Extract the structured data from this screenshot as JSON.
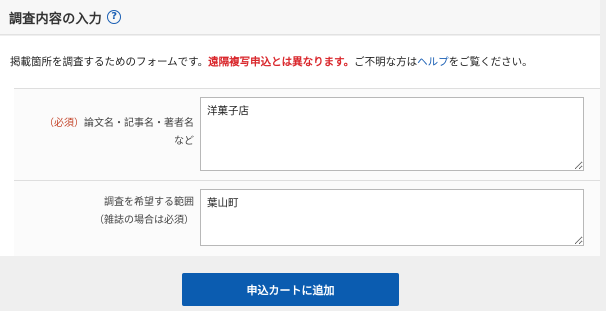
{
  "section": {
    "title": "調査内容の入力",
    "help_icon": "?"
  },
  "description": {
    "text_before": "掲載箇所を調査するためのフォームです。",
    "warning": "遠隔複写申込とは異なります。",
    "text_middle": "ご不明な方は",
    "help_link": "ヘルプ",
    "text_after": "をご覧ください。"
  },
  "form": {
    "rows": [
      {
        "required_label": "（必須）",
        "label_line1": "論文名・記事名・著者名",
        "label_line2": "など",
        "value": "洋菓子店"
      },
      {
        "label_line1": "調査を希望する範囲",
        "label_line2": "（雑誌の場合は必須）",
        "value": "葉山町"
      }
    ]
  },
  "submit": {
    "label": "申込カートに追加"
  },
  "colors": {
    "accent": "#0b5cb0",
    "warning": "#d9262b",
    "required": "#c4452a",
    "link": "#1a5fb4"
  }
}
